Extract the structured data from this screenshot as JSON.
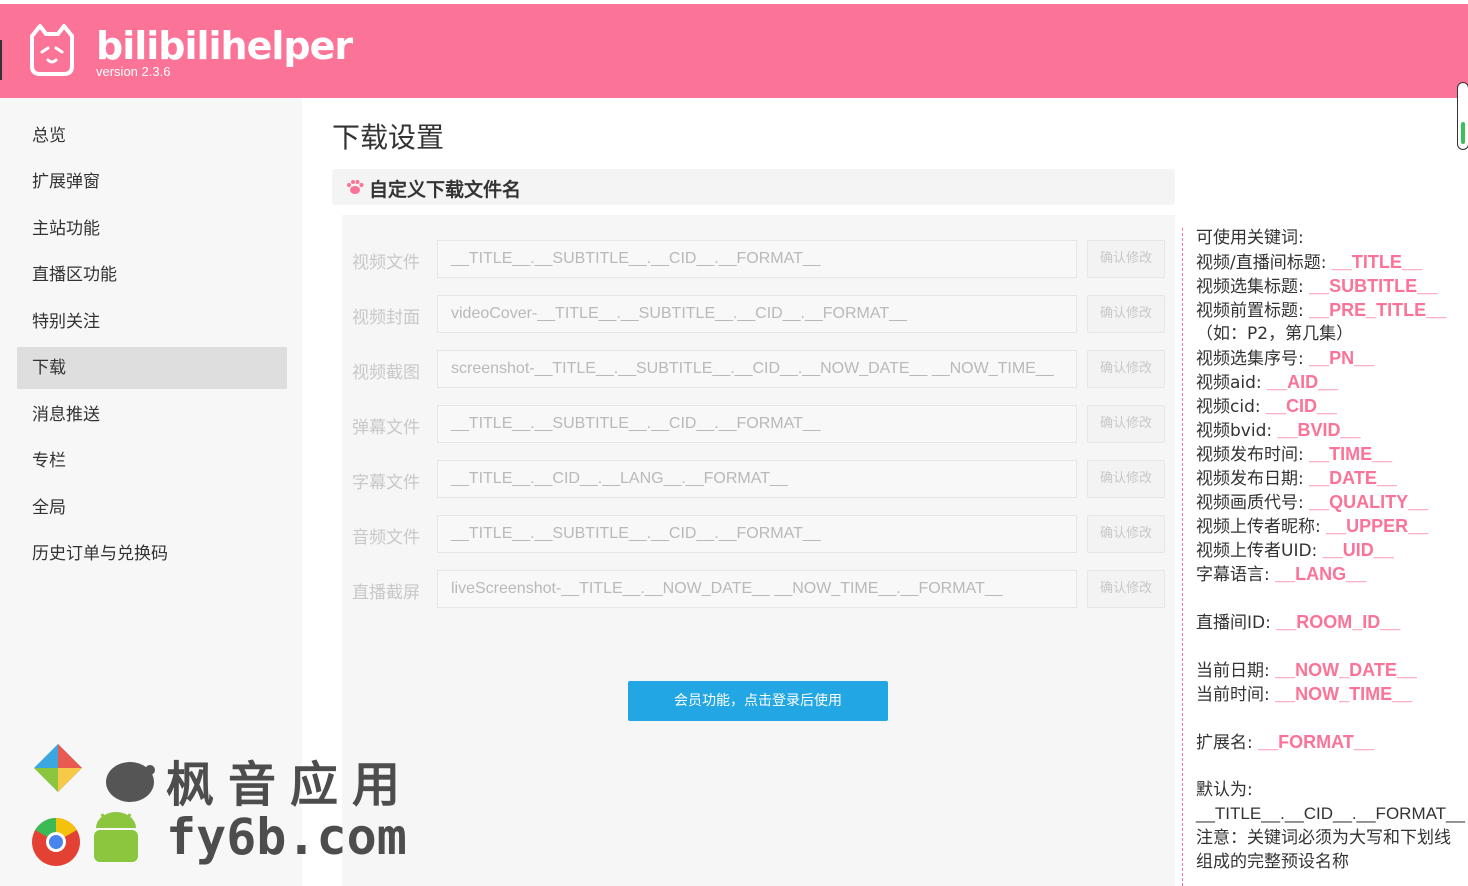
{
  "header": {
    "app_name": "bilibilihelper",
    "version": "version 2.3.6",
    "color": "#fc7398"
  },
  "sidebar": {
    "items": [
      {
        "label": "总览"
      },
      {
        "label": "扩展弹窗"
      },
      {
        "label": "主站功能"
      },
      {
        "label": "直播区功能"
      },
      {
        "label": "特别关注"
      },
      {
        "label": "下载",
        "active": true
      },
      {
        "label": "消息推送"
      },
      {
        "label": "专栏"
      },
      {
        "label": "全局"
      },
      {
        "label": "历史订单与兑换码"
      }
    ]
  },
  "main": {
    "page_title": "下载设置",
    "section_title": "自定义下载文件名",
    "section_icon": "paw-icon",
    "confirm_label": "确认修改",
    "rows": [
      {
        "label": "视频文件",
        "value": "__TITLE__.__SUBTITLE__.__CID__.__FORMAT__"
      },
      {
        "label": "视频封面",
        "value": "videoCover-__TITLE__.__SUBTITLE__.__CID__.__FORMAT__"
      },
      {
        "label": "视频截图",
        "value": "screenshot-__TITLE__.__SUBTITLE__.__CID__.__NOW_DATE__ __NOW_TIME__"
      },
      {
        "label": "弹幕文件",
        "value": "__TITLE__.__SUBTITLE__.__CID__.__FORMAT__"
      },
      {
        "label": "字幕文件",
        "value": "__TITLE__.__CID__.__LANG__.__FORMAT__"
      },
      {
        "label": "音频文件",
        "value": "__TITLE__.__SUBTITLE__.__CID__.__FORMAT__"
      },
      {
        "label": "直播截屏",
        "value": "liveScreenshot-__TITLE__.__NOW_DATE__ __NOW_TIME__.__FORMAT__"
      }
    ],
    "member_button": "会员功能，点击登录后使用"
  },
  "help": {
    "intro": "可使用关键词:",
    "keywords": [
      {
        "k": "视频/直播间标题:",
        "v": "__TITLE__"
      },
      {
        "k": "视频选集标题:",
        "v": "__SUBTITLE__"
      },
      {
        "k": "视频前置标题:",
        "v": "__PRE_TITLE__"
      },
      {
        "k": "视频选集序号:",
        "v": "__PN__"
      },
      {
        "k": "视频aid:",
        "v": "__AID__"
      },
      {
        "k": "视频cid:",
        "v": "__CID__"
      },
      {
        "k": "视频bvid:",
        "v": "__BVID__"
      },
      {
        "k": "视频发布时间:",
        "v": "__TIME__"
      },
      {
        "k": "视频发布日期:",
        "v": "__DATE__"
      },
      {
        "k": "视频画质代号:",
        "v": "__QUALITY__"
      },
      {
        "k": "视频上传者昵称:",
        "v": "__UPPER__"
      },
      {
        "k": "视频上传者UID:",
        "v": "__UID__"
      },
      {
        "k": "字幕语言:",
        "v": "__LANG__"
      }
    ],
    "pre_title_note": "（如：P2，第几集）",
    "room": {
      "k": "直播间ID:",
      "v": "__ROOM_ID__"
    },
    "now_date": {
      "k": "当前日期:",
      "v": "__NOW_DATE__"
    },
    "now_time": {
      "k": "当前时间:",
      "v": "__NOW_TIME__"
    },
    "format": {
      "k": "扩展名:",
      "v": "__FORMAT__"
    },
    "default_label": "默认为:",
    "default_value": "__TITLE__.__CID__.__FORMAT__",
    "note_line1": "注意：关键词必须为大写和下划线",
    "note_line2": "组成的完整预设名称"
  },
  "watermark": {
    "name": "枫音应用",
    "site": "fy6b.com"
  }
}
